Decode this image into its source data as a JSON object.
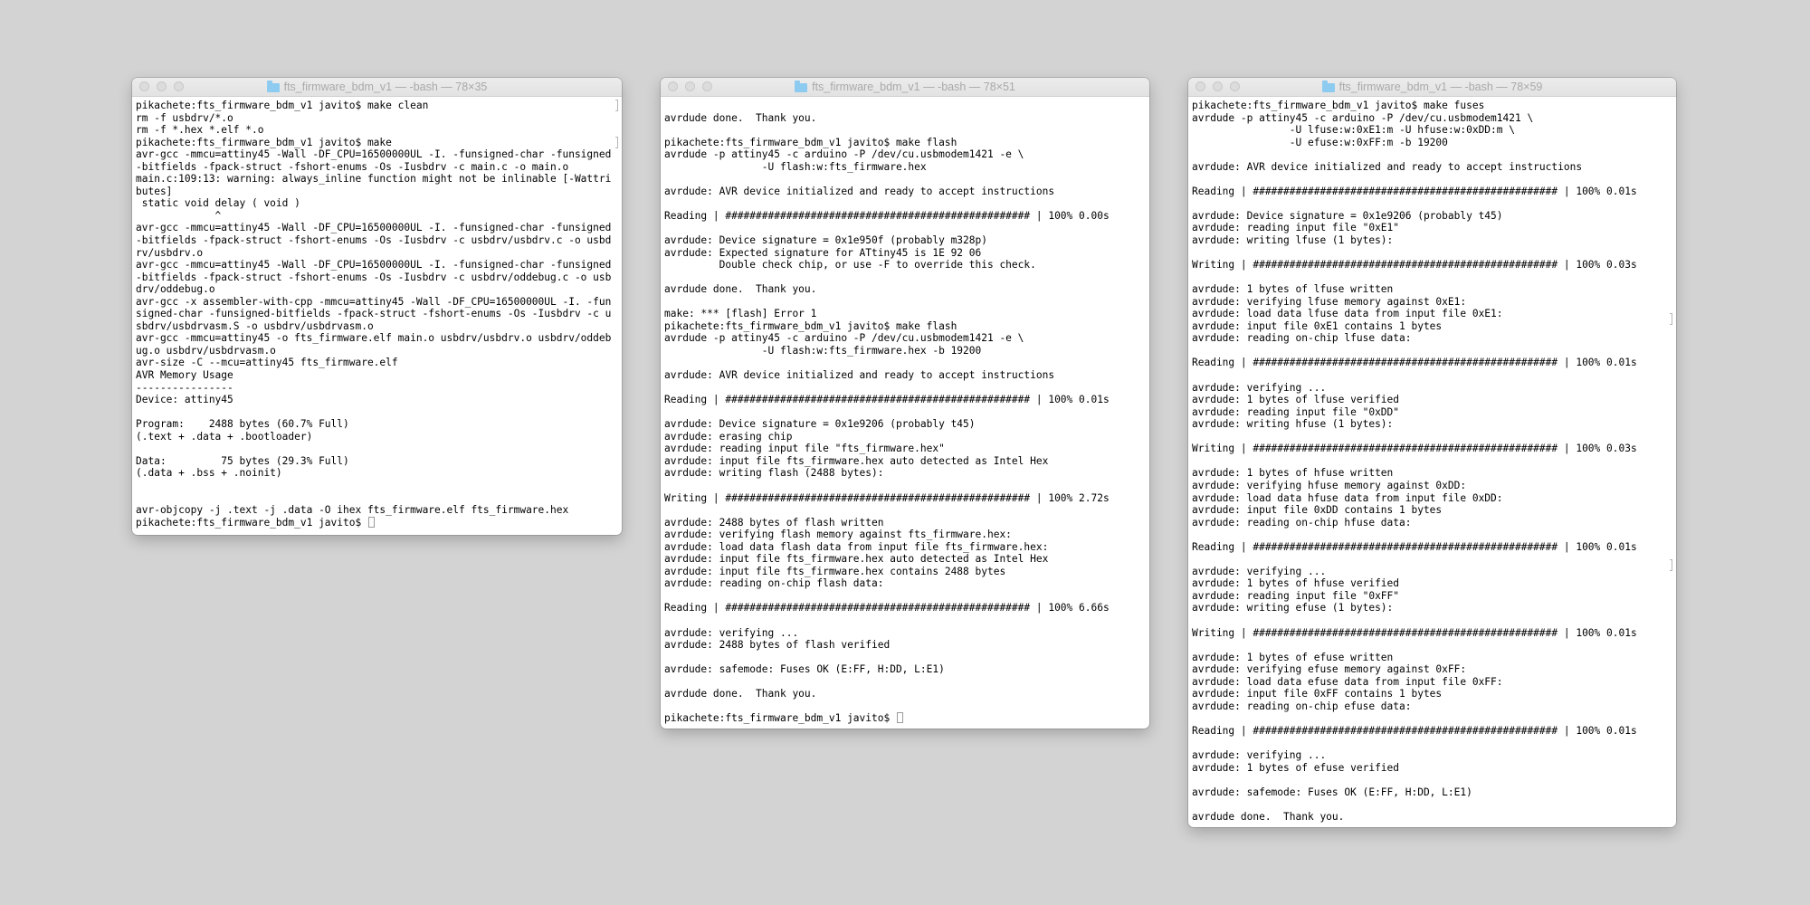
{
  "windows": [
    {
      "title": "fts_firmware_bdm_v1 — -bash — 78×35",
      "lines": [
        "pikachete:fts_firmware_bdm_v1 javito$ make clean",
        "rm -f usbdrv/*.o",
        "rm -f *.hex *.elf *.o",
        "pikachete:fts_firmware_bdm_v1 javito$ make",
        "avr-gcc -mmcu=attiny45 -Wall -DF_CPU=16500000UL -I. -funsigned-char -funsigned",
        "-bitfields -fpack-struct -fshort-enums -Os -Iusbdrv -c main.c -o main.o",
        "main.c:109:13: warning: always_inline function might not be inlinable [-Wattri",
        "butes]",
        " static void delay ( void )",
        "             ^",
        "avr-gcc -mmcu=attiny45 -Wall -DF_CPU=16500000UL -I. -funsigned-char -funsigned",
        "-bitfields -fpack-struct -fshort-enums -Os -Iusbdrv -c usbdrv/usbdrv.c -o usbd",
        "rv/usbdrv.o",
        "avr-gcc -mmcu=attiny45 -Wall -DF_CPU=16500000UL -I. -funsigned-char -funsigned",
        "-bitfields -fpack-struct -fshort-enums -Os -Iusbdrv -c usbdrv/oddebug.c -o usb",
        "drv/oddebug.o",
        "avr-gcc -x assembler-with-cpp -mmcu=attiny45 -Wall -DF_CPU=16500000UL -I. -fun",
        "signed-char -funsigned-bitfields -fpack-struct -fshort-enums -Os -Iusbdrv -c u",
        "sbdrv/usbdrvasm.S -o usbdrv/usbdrvasm.o",
        "avr-gcc -mmcu=attiny45 -o fts_firmware.elf main.o usbdrv/usbdrv.o usbdrv/oddeb",
        "ug.o usbdrv/usbdrvasm.o",
        "avr-size -C --mcu=attiny45 fts_firmware.elf",
        "AVR Memory Usage",
        "----------------",
        "Device: attiny45",
        "",
        "Program:    2488 bytes (60.7% Full)",
        "(.text + .data + .bootloader)",
        "",
        "Data:         75 bytes (29.3% Full)",
        "(.data + .bss + .noinit)",
        "",
        "",
        "avr-objcopy -j .text -j .data -O ihex fts_firmware.elf fts_firmware.hex",
        "pikachete:fts_firmware_bdm_v1 javito$ "
      ]
    },
    {
      "title": "fts_firmware_bdm_v1 — -bash — 78×51",
      "lines": [
        "",
        "avrdude done.  Thank you.",
        "",
        "pikachete:fts_firmware_bdm_v1 javito$ make flash",
        "avrdude -p attiny45 -c arduino -P /dev/cu.usbmodem1421 -e \\",
        "                -U flash:w:fts_firmware.hex",
        "",
        "avrdude: AVR device initialized and ready to accept instructions",
        "",
        "Reading | ################################################## | 100% 0.00s",
        "",
        "avrdude: Device signature = 0x1e950f (probably m328p)",
        "avrdude: Expected signature for ATtiny45 is 1E 92 06",
        "         Double check chip, or use -F to override this check.",
        "",
        "avrdude done.  Thank you.",
        "",
        "make: *** [flash] Error 1",
        "pikachete:fts_firmware_bdm_v1 javito$ make flash",
        "avrdude -p attiny45 -c arduino -P /dev/cu.usbmodem1421 -e \\",
        "                -U flash:w:fts_firmware.hex -b 19200",
        "",
        "avrdude: AVR device initialized and ready to accept instructions",
        "",
        "Reading | ################################################## | 100% 0.01s",
        "",
        "avrdude: Device signature = 0x1e9206 (probably t45)",
        "avrdude: erasing chip",
        "avrdude: reading input file \"fts_firmware.hex\"",
        "avrdude: input file fts_firmware.hex auto detected as Intel Hex",
        "avrdude: writing flash (2488 bytes):",
        "",
        "Writing | ################################################## | 100% 2.72s",
        "",
        "avrdude: 2488 bytes of flash written",
        "avrdude: verifying flash memory against fts_firmware.hex:",
        "avrdude: load data flash data from input file fts_firmware.hex:",
        "avrdude: input file fts_firmware.hex auto detected as Intel Hex",
        "avrdude: input file fts_firmware.hex contains 2488 bytes",
        "avrdude: reading on-chip flash data:",
        "",
        "Reading | ################################################## | 100% 6.66s",
        "",
        "avrdude: verifying ...",
        "avrdude: 2488 bytes of flash verified",
        "",
        "avrdude: safemode: Fuses OK (E:FF, H:DD, L:E1)",
        "",
        "avrdude done.  Thank you.",
        "",
        "pikachete:fts_firmware_bdm_v1 javito$ "
      ]
    },
    {
      "title": "fts_firmware_bdm_v1 — -bash — 78×59",
      "lines": [
        "pikachete:fts_firmware_bdm_v1 javito$ make fuses",
        "avrdude -p attiny45 -c arduino -P /dev/cu.usbmodem1421 \\",
        "                -U lfuse:w:0xE1:m -U hfuse:w:0xDD:m \\",
        "                -U efuse:w:0xFF:m -b 19200",
        "",
        "avrdude: AVR device initialized and ready to accept instructions",
        "",
        "Reading | ################################################## | 100% 0.01s",
        "",
        "avrdude: Device signature = 0x1e9206 (probably t45)",
        "avrdude: reading input file \"0xE1\"",
        "avrdude: writing lfuse (1 bytes):",
        "",
        "Writing | ################################################## | 100% 0.03s",
        "",
        "avrdude: 1 bytes of lfuse written",
        "avrdude: verifying lfuse memory against 0xE1:",
        "avrdude: load data lfuse data from input file 0xE1:",
        "avrdude: input file 0xE1 contains 1 bytes",
        "avrdude: reading on-chip lfuse data:",
        "",
        "Reading | ################################################## | 100% 0.01s",
        "",
        "avrdude: verifying ...",
        "avrdude: 1 bytes of lfuse verified",
        "avrdude: reading input file \"0xDD\"",
        "avrdude: writing hfuse (1 bytes):",
        "",
        "Writing | ################################################## | 100% 0.03s",
        "",
        "avrdude: 1 bytes of hfuse written",
        "avrdude: verifying hfuse memory against 0xDD:",
        "avrdude: load data hfuse data from input file 0xDD:",
        "avrdude: input file 0xDD contains 1 bytes",
        "avrdude: reading on-chip hfuse data:",
        "",
        "Reading | ################################################## | 100% 0.01s",
        "",
        "avrdude: verifying ...",
        "avrdude: 1 bytes of hfuse verified",
        "avrdude: reading input file \"0xFF\"",
        "avrdude: writing efuse (1 bytes):",
        "",
        "Writing | ################################################## | 100% 0.01s",
        "",
        "avrdude: 1 bytes of efuse written",
        "avrdude: verifying efuse memory against 0xFF:",
        "avrdude: load data efuse data from input file 0xFF:",
        "avrdude: input file 0xFF contains 1 bytes",
        "avrdude: reading on-chip efuse data:",
        "",
        "Reading | ################################################## | 100% 0.01s",
        "",
        "avrdude: verifying ...",
        "avrdude: 1 bytes of efuse verified",
        "",
        "avrdude: safemode: Fuses OK (E:FF, H:DD, L:E1)",
        "",
        "avrdude done.  Thank you."
      ]
    }
  ]
}
